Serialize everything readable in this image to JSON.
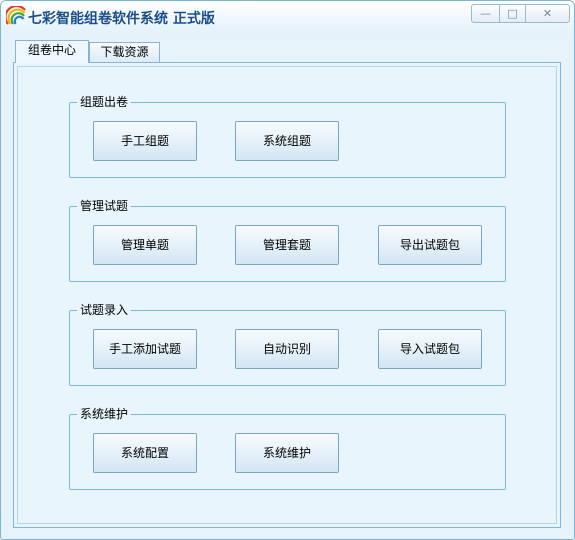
{
  "window": {
    "title": "七彩智能组卷软件系统  正式版",
    "controls": {
      "minimize": "—",
      "maximize": "□",
      "close": "✕"
    }
  },
  "tabs": [
    {
      "label": "组卷中心",
      "active": true
    },
    {
      "label": "下载资源",
      "active": false
    }
  ],
  "groups": [
    {
      "label": "组题出卷",
      "buttons": [
        "手工组题",
        "系统组题"
      ]
    },
    {
      "label": "管理试题",
      "buttons": [
        "管理单题",
        "管理套题",
        "导出试题包"
      ]
    },
    {
      "label": "试题录入",
      "buttons": [
        "手工添加试题",
        "自动识别",
        "导入试题包"
      ]
    },
    {
      "label": "系统维护",
      "buttons": [
        "系统配置",
        "系统维护"
      ]
    }
  ],
  "icons": {
    "app": "rainbow-icon"
  }
}
